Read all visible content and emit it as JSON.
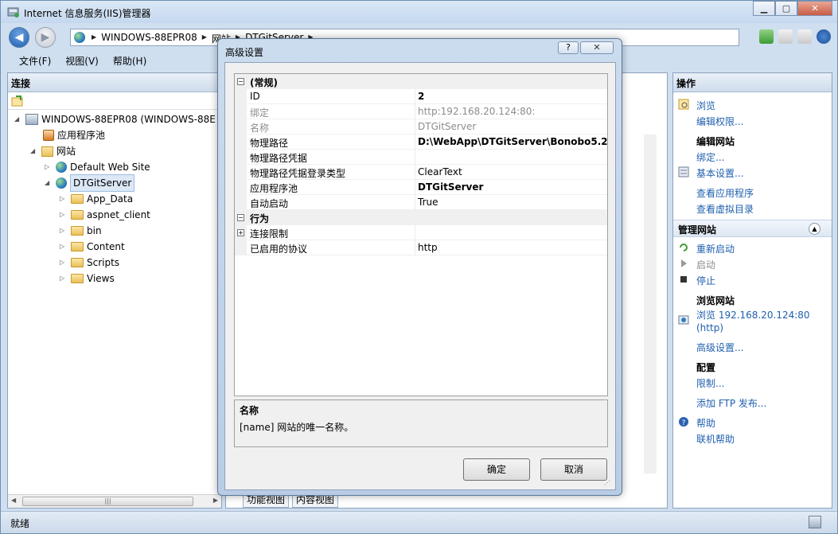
{
  "window": {
    "title": "Internet 信息服务(IIS)管理器",
    "min_label": "▁",
    "max_label": "▢",
    "close_label": "✕"
  },
  "address": {
    "crumbs": [
      "WINDOWS-88EPR08",
      "网站",
      "DTGitServer"
    ]
  },
  "menu": [
    "文件(F)",
    "视图(V)",
    "帮助(H)"
  ],
  "connections": {
    "header": "连接",
    "tree": {
      "server": "WINDOWS-88EPR08 (WINDOWS-88E",
      "app_pools": "应用程序池",
      "sites": "网站",
      "default_site": "Default Web Site",
      "dtgit": "DTGitServer",
      "folders": [
        "App_Data",
        "aspnet_client",
        "bin",
        "Content",
        "Scripts",
        "Views"
      ]
    }
  },
  "middle": {
    "tab_features": "功能视图",
    "tab_content": "内容视图"
  },
  "actions": {
    "header": "操作",
    "browse": "浏览",
    "edit_permissions": "编辑权限...",
    "edit_site": "编辑网站",
    "bindings": "绑定...",
    "basic_settings": "基本设置...",
    "view_apps": "查看应用程序",
    "view_vdirs": "查看虚拟目录",
    "manage_site": "管理网站",
    "restart": "重新启动",
    "start": "启动",
    "stop": "停止",
    "browse_site": "浏览网站",
    "browse_link_1": "浏览 192.168.20.124:80",
    "browse_link_2": "(http)",
    "advanced_settings": "高级设置...",
    "config": "配置",
    "limits": "限制...",
    "add_ftp": "添加 FTP 发布...",
    "help": "帮助",
    "online_help": "联机帮助"
  },
  "status": {
    "text": "就绪"
  },
  "dialog": {
    "title": "高级设置",
    "help_label": "?",
    "close_label": "✕",
    "categories": {
      "general": "(常规)",
      "behavior": "行为"
    },
    "rows": [
      {
        "key": "ID",
        "value": "2"
      },
      {
        "key": "绑定",
        "value": "http:192.168.20.124:80:"
      },
      {
        "key": "名称",
        "value": "DTGitServer"
      },
      {
        "key": "物理路径",
        "value": "D:\\WebApp\\DTGitServer\\Bonobo5.2"
      },
      {
        "key": "物理路径凭据",
        "value": ""
      },
      {
        "key": "物理路径凭据登录类型",
        "value": "ClearText"
      },
      {
        "key": "应用程序池",
        "value": "DTGitServer"
      },
      {
        "key": "自动启动",
        "value": "True"
      }
    ],
    "behavior_rows": [
      {
        "key": "连接限制",
        "value": ""
      },
      {
        "key": "已启用的协议",
        "value": "http"
      }
    ],
    "description": {
      "title": "名称",
      "text": "[name] 网站的唯一名称。"
    },
    "ok_label": "确定",
    "cancel_label": "取消"
  }
}
